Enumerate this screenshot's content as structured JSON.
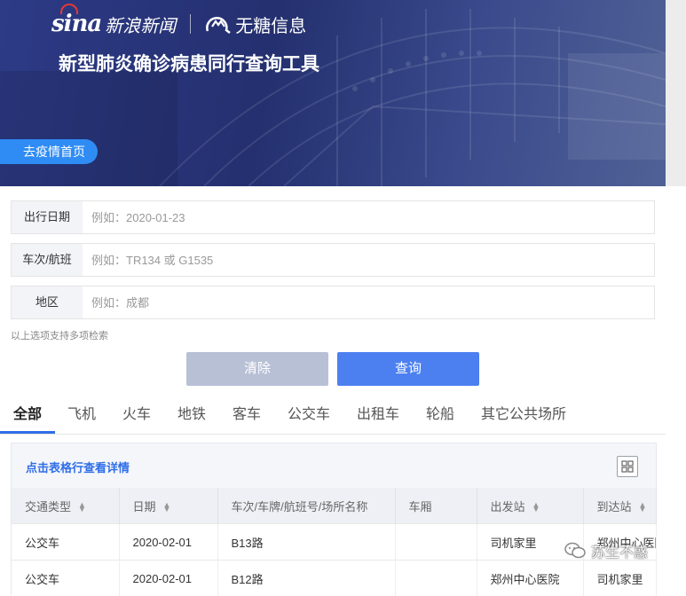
{
  "header": {
    "sina_logo": "sina",
    "sina_name": "新浪新闻",
    "partner_name": "无糖信息",
    "title": "新型肺炎确诊病患同行查询工具",
    "home_button": "去疫情首页"
  },
  "form": {
    "date": {
      "label": "出行日期",
      "placeholder": "例如：2020-01-23"
    },
    "trip": {
      "label": "车次/航班",
      "placeholder": "例如：TR134 或 G1535"
    },
    "region": {
      "label": "地区",
      "placeholder": "例如：成都"
    },
    "hint": "以上选项支持多项检索",
    "clear_label": "清除",
    "query_label": "查询"
  },
  "tabs": [
    "全部",
    "飞机",
    "火车",
    "地铁",
    "客车",
    "公交车",
    "出租车",
    "轮船",
    "其它公共场所"
  ],
  "results": {
    "title": "点击表格行查看详情",
    "columns": [
      "交通类型",
      "日期",
      "车次/车牌/航班号/场所名称",
      "车厢",
      "出发站",
      "到达站"
    ],
    "rows": [
      [
        "公交车",
        "2020-02-01",
        "B13路",
        "",
        "司机家里",
        "郑州中心医院"
      ],
      [
        "公交车",
        "2020-02-01",
        "B12路",
        "",
        "郑州中心医院",
        "司机家里"
      ]
    ]
  },
  "watermark": "苏生不惑",
  "colors": {
    "primary": "#4c80f0",
    "link": "#2f6ee8",
    "banner": "#2d3a86",
    "clear": "#b8c0d6"
  },
  "icons": [
    "sina-eye-icon",
    "wutang-logo-icon",
    "grid-view-icon",
    "sort-icon",
    "wechat-icon"
  ]
}
